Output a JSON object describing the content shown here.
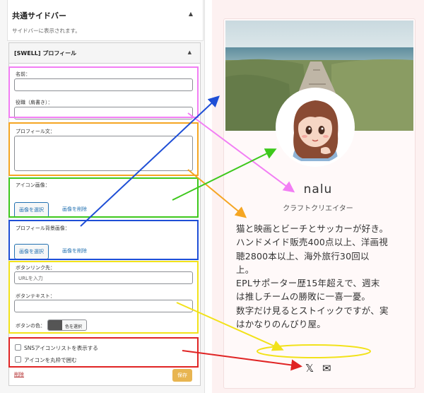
{
  "sidebar": {
    "title": "共通サイドバー",
    "description": "サイドバーに表示されます。"
  },
  "widget": {
    "title": "[SWELL] プロフィール",
    "name_label": "名前：",
    "job_label": "役職（肩書き）：",
    "bio_label": "プロフィール文：",
    "icon_label": "アイコン画像：",
    "bg_label": "プロフィール背景画像：",
    "select_image": "画像を選択",
    "delete_image": "画像を削除",
    "link_label": "ボタンリンク先：",
    "link_placeholder": "URLを入力",
    "btn_text_label": "ボタンテキスト：",
    "btn_color_label": "ボタンの色：",
    "color_select": "色を選択",
    "sns_label": "SNSアイコンリストを表示する",
    "circle_label": "アイコンを丸枠で囲む",
    "remove": "削除",
    "save": "保存"
  },
  "profile": {
    "name": "nalu",
    "role": "クラフトクリエイター",
    "bio_lines": [
      "猫と映画とビーチとサッカーが好き。",
      "ハンドメイド販売400点以上、洋画視",
      "聴2800本以上、海外旅行30回以",
      "上。",
      "EPLサポーター歴15年超えで、週末",
      "は推しチームの勝敗に一喜一憂。",
      "数字だけ見るとストイックですが、実",
      "はかなりのんびり屋。"
    ],
    "sns_x": "𝕏",
    "sns_mail": "✉"
  },
  "colors": {
    "pink": "#f27ef4",
    "orange": "#f5a623",
    "green": "#3ec81c",
    "blue": "#1f4fd6",
    "yellow": "#f2e21a",
    "red": "#e02424",
    "button_color": "#555555"
  },
  "icons": {
    "sns_x": "x-twitter-icon",
    "sns_mail": "mail-icon",
    "collapse": "caret-up-icon"
  }
}
